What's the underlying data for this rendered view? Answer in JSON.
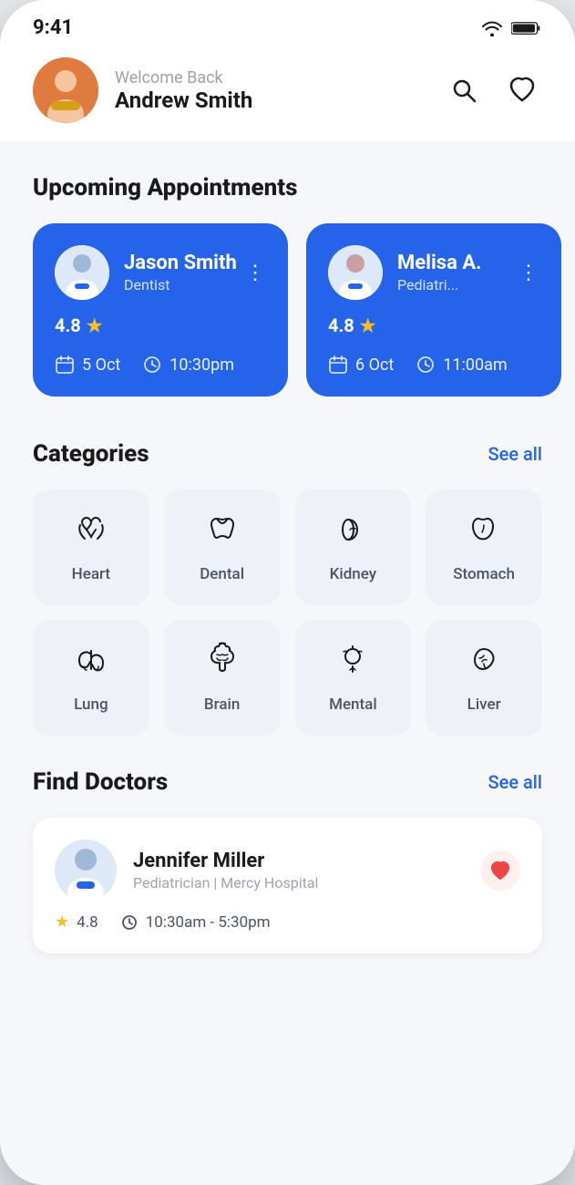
{
  "statusBar": {
    "time": "9:41"
  },
  "header": {
    "welcome": "Welcome Back",
    "name": "Andrew Smith",
    "searchLabel": "search",
    "favoriteLabel": "favorite"
  },
  "appointments": {
    "sectionTitle": "Upcoming Appointments",
    "cards": [
      {
        "doctorName": "Jason Smith",
        "specialty": "Dentist",
        "rating": "4.8",
        "date": "5 Oct",
        "time": "10:30pm"
      },
      {
        "doctorName": "Melisa A.",
        "specialty": "Pediatri...",
        "rating": "4.8",
        "date": "6 Oct",
        "time": "11:00am"
      }
    ]
  },
  "categories": {
    "sectionTitle": "Categories",
    "seeAll": "See all",
    "items": [
      {
        "label": "Heart",
        "icon": "🫀"
      },
      {
        "label": "Dental",
        "icon": "🦷"
      },
      {
        "label": "Kidney",
        "icon": "🫘"
      },
      {
        "label": "Stomach",
        "icon": "🫃"
      },
      {
        "label": "Lung",
        "icon": "🫁"
      },
      {
        "label": "Brain",
        "icon": "🧠"
      },
      {
        "label": "Mental",
        "icon": "🌿"
      },
      {
        "label": "Liver",
        "icon": "🍀"
      }
    ]
  },
  "findDoctors": {
    "sectionTitle": "Find Doctors",
    "seeAll": "See all",
    "doctors": [
      {
        "name": "Jennifer Miller",
        "specialty": "Pediatrician | Mercy Hospital",
        "rating": "4.8",
        "hours": "10:30am - 5:30pm"
      }
    ]
  }
}
